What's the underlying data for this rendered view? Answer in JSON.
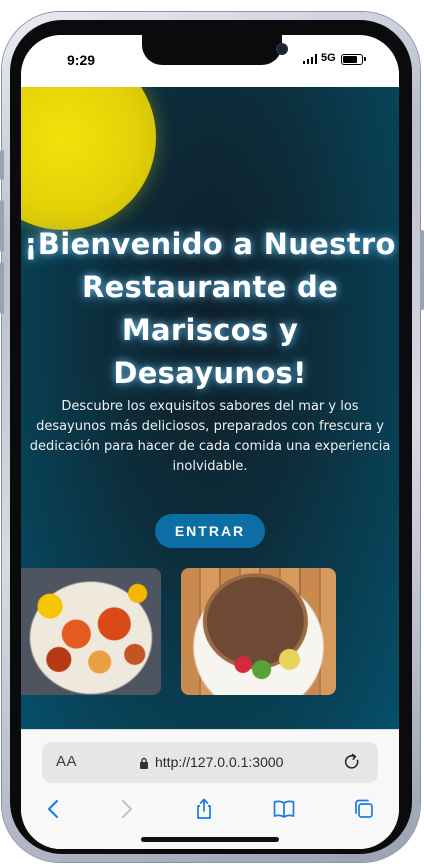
{
  "status_bar": {
    "time": "9:29",
    "network": "5G",
    "battery_level": 0.85
  },
  "hero": {
    "title": "¡Bienvenido a Nuestro Restaurante de Mariscos y Desayunos!",
    "description": "Descubre los exquisitos sabores del mar y los desayunos más deliciosos, preparados con frescura y dedicación para hacer de cada comida una experiencia inolvidable.",
    "enter_label": "ENTRAR"
  },
  "browser": {
    "text_size_label": "AA",
    "url": "http://127.0.0.1:3000"
  },
  "colors": {
    "accent_button": "#0b6fa6",
    "sun": "#e8d60a",
    "background_dark": "#0d2d3b",
    "browser_icons": "#1a7be0"
  }
}
